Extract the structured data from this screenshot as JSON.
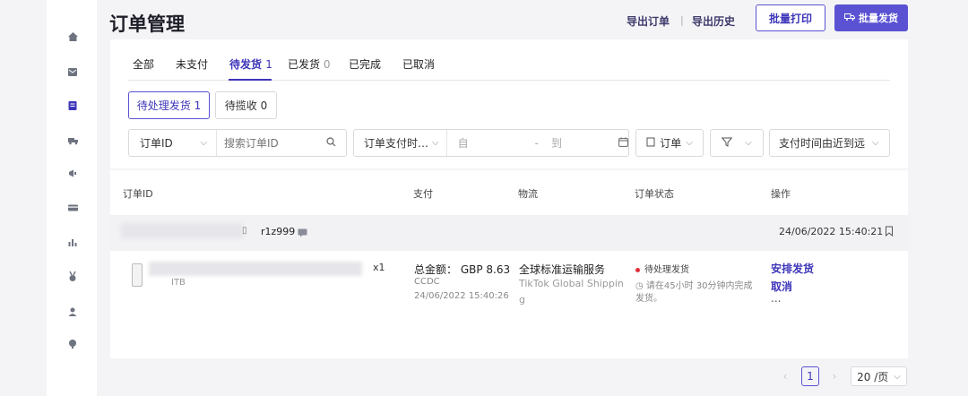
{
  "sidebar": {
    "icons": [
      "home-icon",
      "mail-icon",
      "orders-icon",
      "shipping-icon",
      "marketing-icon",
      "finance-icon",
      "analytics-icon",
      "rewards-icon",
      "account-icon",
      "support-icon"
    ],
    "active_index": 2
  },
  "header": {
    "title": "订单管理",
    "export_orders": "导出订单",
    "separator": "|",
    "export_history": "导出历史",
    "bulk_print": "批量打印",
    "bulk_ship": "批量发货"
  },
  "tabs": [
    {
      "label": "全部",
      "count": ""
    },
    {
      "label": "未支付",
      "count": ""
    },
    {
      "label": "待发货",
      "count": "1"
    },
    {
      "label": "已发货",
      "count": "0"
    },
    {
      "label": "已完成",
      "count": ""
    },
    {
      "label": "已取消",
      "count": ""
    }
  ],
  "subtabs": [
    {
      "label": "待处理发货 1"
    },
    {
      "label": "待揽收 0"
    }
  ],
  "filters": {
    "id_select": "订单ID",
    "search_placeholder": "搜索订单ID",
    "date_select": "订单支付时…",
    "date_from": "自",
    "date_dash": "-",
    "date_to": "到",
    "order_flag": "订单",
    "sort": "支付时间由近到远"
  },
  "table": {
    "headers": [
      "订单ID",
      "支付",
      "物流",
      "订单状态",
      "操作"
    ],
    "order": {
      "buyer": "r1z999",
      "created_at": "24/06/2022 15:40:21",
      "product_code": "ITB",
      "quantity": "x1",
      "total_label": "总金额：",
      "total_value": "GBP 8.63",
      "payment_method": "CCDC",
      "paid_at": "24/06/2022 15:40:26",
      "logistics_name": "全球标准运输服务",
      "logistics_provider_line1": "TikTok Global Shippin",
      "logistics_provider_line2": "g",
      "status": "待处理发货",
      "status_note_line1": "请在45小时 30分钟内完成",
      "status_note_line2": "发货。",
      "action_ship": "安排发货",
      "action_cancel": "取消",
      "action_more": "..."
    }
  },
  "pagination": {
    "prev": "‹",
    "current_page": "1",
    "next": "›",
    "page_size": "20 /页"
  },
  "colors": {
    "accent": "#5a52d2",
    "accent_text": "#3d35b9",
    "status_red": "#e0303a"
  }
}
